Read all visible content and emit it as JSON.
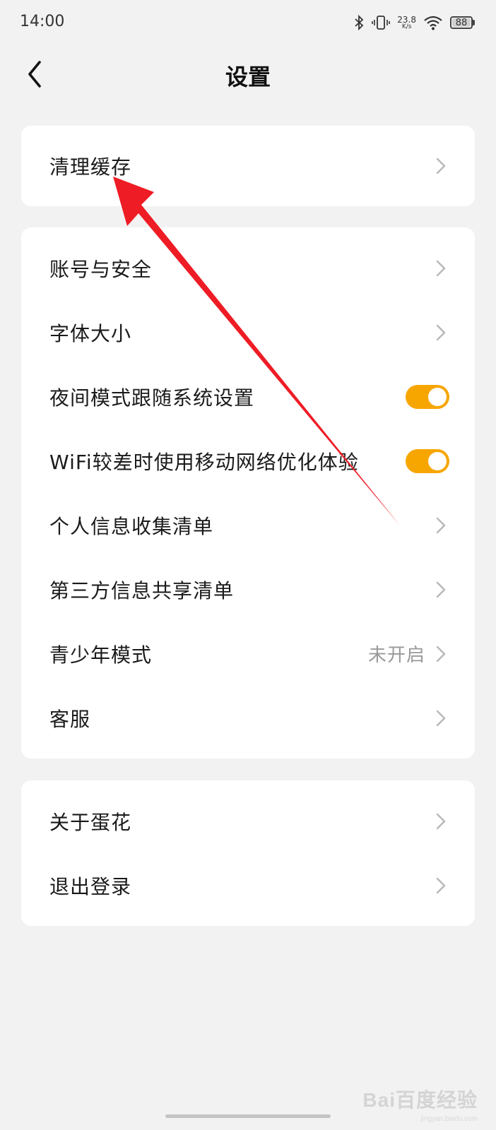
{
  "status_bar": {
    "time": "14:00",
    "net_speed_value": "23.8",
    "net_speed_unit": "K/s",
    "battery": "88",
    "icons": [
      "bluetooth-icon",
      "vibrate-icon",
      "wifi-icon",
      "battery-icon"
    ]
  },
  "nav": {
    "title": "设置",
    "back_icon": "chevron-left-icon"
  },
  "groups": {
    "cache": {
      "label": "清理缓存"
    },
    "main": {
      "account": "账号与安全",
      "font_size": "字体大小",
      "night_mode": "夜间模式跟随系统设置",
      "wifi_optimize": "WiFi较差时使用移动网络优化体验",
      "personal_info": "个人信息收集清单",
      "third_party": "第三方信息共享清单",
      "teen_mode": "青少年模式",
      "teen_mode_value": "未开启",
      "service": "客服"
    },
    "about": {
      "about": "关于蛋花",
      "logout": "退出登录"
    }
  },
  "toggles": {
    "night_mode_on": true,
    "wifi_optimize_on": true
  },
  "colors": {
    "accent": "#f7a600",
    "annotation_arrow": "#ee1c25",
    "background": "#f2f2f2"
  },
  "watermark": {
    "main": "Bai百度经验",
    "sub": "jingyan.baidu.com"
  }
}
